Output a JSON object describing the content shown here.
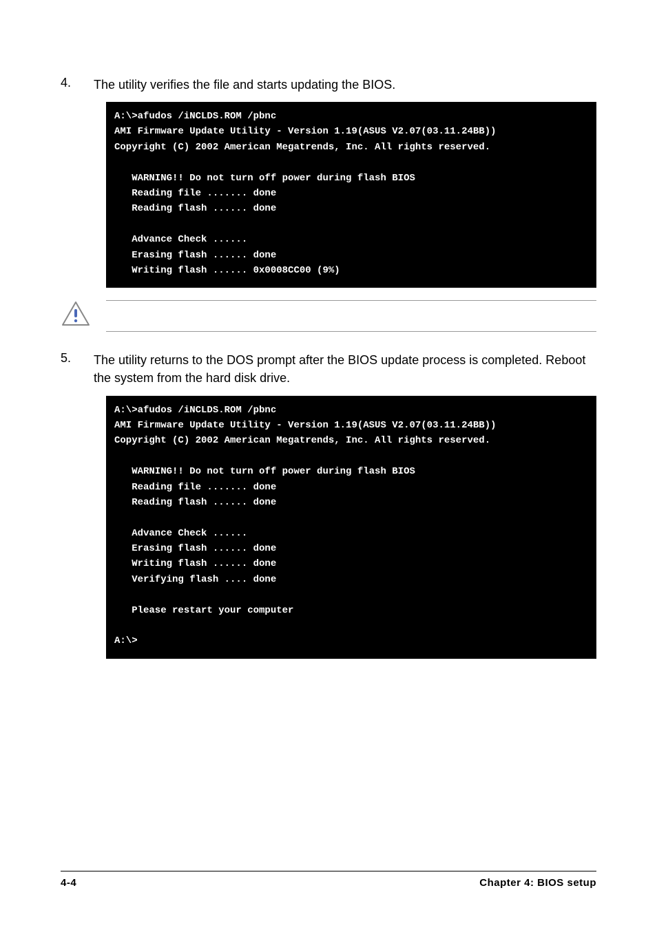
{
  "steps": {
    "s4": {
      "num": "4.",
      "text": "The utility verifies the file and starts updating the BIOS."
    },
    "s5": {
      "num": "5.",
      "text": "The utility returns to the DOS prompt after the BIOS update process is completed. Reboot the system from the hard disk drive."
    }
  },
  "term1": {
    "l1": "A:\\>afudos /iNCLDS.ROM /pbnc",
    "l2": "AMI Firmware Update Utility - Version 1.19(ASUS V2.07(03.11.24BB))",
    "l3": "Copyright (C) 2002 American Megatrends, Inc. All rights reserved.",
    "l4": "   WARNING!! Do not turn off power during flash BIOS",
    "l5": "   Reading file ....... done",
    "l6": "   Reading flash ...... done",
    "l7": "   Advance Check ......",
    "l8": "   Erasing flash ...... done",
    "l9": "   Writing flash ...... 0x0008CC00 (9%)"
  },
  "term2": {
    "l1": "A:\\>afudos /iNCLDS.ROM /pbnc",
    "l2": "AMI Firmware Update Utility - Version 1.19(ASUS V2.07(03.11.24BB))",
    "l3": "Copyright (C) 2002 American Megatrends, Inc. All rights reserved.",
    "l4": "   WARNING!! Do not turn off power during flash BIOS",
    "l5": "   Reading file ....... done",
    "l6": "   Reading flash ...... done",
    "l7": "   Advance Check ......",
    "l8": "   Erasing flash ...... done",
    "l9": "   Writing flash ...... done",
    "l10": "   Verifying flash .... done",
    "l11": "   Please restart your computer",
    "l12": "A:\\>"
  },
  "footer": {
    "left": "4-4",
    "right": "Chapter 4: BIOS setup"
  }
}
